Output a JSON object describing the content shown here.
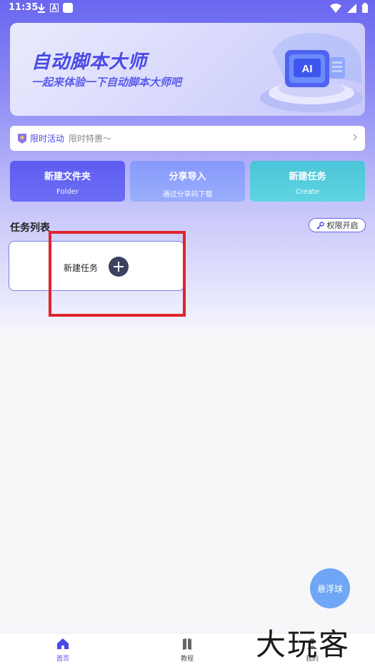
{
  "status_bar": {
    "time": "11:35",
    "icons": [
      "download-icon",
      "a-icon",
      "square-icon",
      "wifi-icon",
      "signal-icon",
      "battery-icon"
    ]
  },
  "banner": {
    "title": "自动脚本大师",
    "subtitle": "一起来体验一下自动脚本大师吧",
    "art_label": "AI"
  },
  "promo": {
    "label": "限时活动",
    "text": "限时特惠〜"
  },
  "actions": [
    {
      "title": "新建文件夹",
      "subtitle": "Folder",
      "color": "#5d5af0"
    },
    {
      "title": "分享导入",
      "subtitle": "通过分享码下载",
      "color": "#8aa0fb"
    },
    {
      "title": "新建任务",
      "subtitle": "Create",
      "color": "#4fc9d9"
    }
  ],
  "tasks": {
    "section_title": "任务列表",
    "permission_button": "权限开启",
    "new_task_label": "新建任务"
  },
  "float_ball": {
    "label": "悬浮球"
  },
  "bottom_nav": [
    {
      "label": "首页",
      "icon": "home-icon",
      "active": true
    },
    {
      "label": "教程",
      "icon": "book-icon",
      "active": false
    },
    {
      "label": "我的",
      "icon": "user-icon",
      "active": false
    }
  ],
  "watermark": {
    "text": "大玩客"
  },
  "colors": {
    "accent": "#4a49e6",
    "highlight": "#e0242c"
  }
}
